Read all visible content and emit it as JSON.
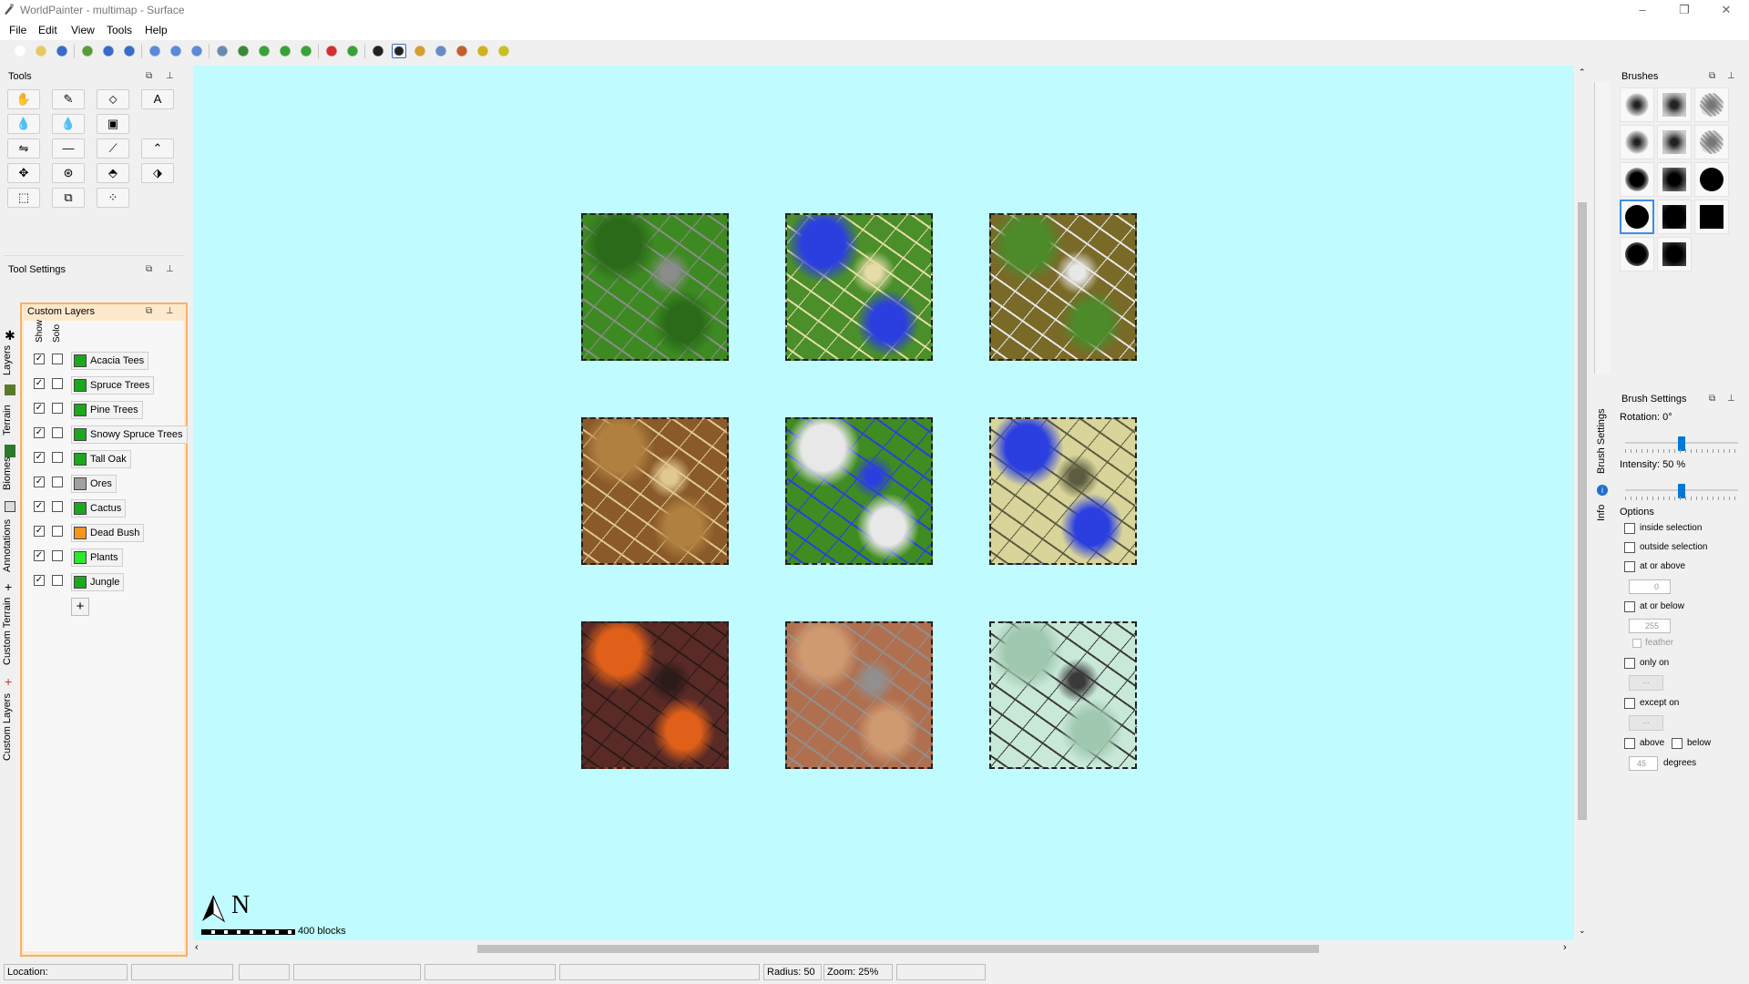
{
  "window": {
    "title": "WorldPainter - multimap - Surface",
    "controls": [
      "–",
      "❐",
      "✕"
    ]
  },
  "menu": [
    "File",
    "Edit",
    "View",
    "Tools",
    "Help"
  ],
  "toolbar_icons": [
    "new-icon",
    "open-icon",
    "save-icon",
    "export-icon",
    "undo-icon",
    "redo-icon",
    "zoom-in-icon",
    "zoom-reset-icon",
    "zoom-out-icon",
    "dimension-properties-icon",
    "raise-icon",
    "rotate-icon",
    "shift-icon",
    "add-tile-icon",
    "view-3d-icon",
    "fit-icon",
    "crosshair-icon",
    "target-icon",
    "image-icon",
    "eye-icon",
    "person-icon",
    "globe-icon",
    "ball-icon"
  ],
  "tools_panel": {
    "title": "Tools",
    "buttons": [
      [
        "✋",
        "✎",
        "⬦",
        "A"
      ],
      [
        "💧",
        "💧",
        "▣"
      ],
      [
        "⇋",
        "—",
        "⟋",
        "⌃"
      ],
      [
        "✥",
        "⊛",
        "⬘",
        "⬗"
      ],
      [
        "⬚",
        "⧉",
        "⁘"
      ]
    ]
  },
  "tool_settings": {
    "title": "Tool Settings"
  },
  "custom_layers": {
    "title": "Custom Layers",
    "col_show": "Show",
    "col_solo": "Solo",
    "add_label": "+",
    "items": [
      {
        "name": "Acacia Tees",
        "show": "☑",
        "color": "#1ca81c"
      },
      {
        "name": "Spruce Trees",
        "show": "☑",
        "color": "#1ca81c"
      },
      {
        "name": "Pine Trees",
        "show": "☑",
        "color": "#1ca81c"
      },
      {
        "name": "Snowy Spruce Trees",
        "show": "☑",
        "color": "#1ca81c"
      },
      {
        "name": "Tall Oak",
        "show": "☑",
        "color": "#1ca81c"
      },
      {
        "name": "Ores",
        "show": "☑",
        "color": "#a0a0a0"
      },
      {
        "name": "Cactus",
        "show": "☑",
        "color": "#1ca81c"
      },
      {
        "name": "Dead Bush",
        "show": "☑",
        "color": "#f7941d"
      },
      {
        "name": "Plants",
        "show": "☑",
        "color": "#2ee82e"
      },
      {
        "name": "Jungle",
        "show": "☑",
        "color": "#1ca81c"
      }
    ]
  },
  "left_tabs": [
    "Layers",
    "Terrain",
    "Biomes",
    "Annotations",
    "Custom Terrain",
    "Custom Layers"
  ],
  "map": {
    "background": "#c0fcff",
    "tiles": [
      {
        "base": "#3d8a22",
        "accent": "#8c8c8c",
        "accent2": "#2a6a18"
      },
      {
        "base": "#4a8f2a",
        "accent": "#e6dca8",
        "accent2": "#2b3fe0"
      },
      {
        "base": "#7a6a28",
        "accent": "#e8e8e8",
        "accent2": "#4c8a2a"
      },
      {
        "base": "#8a5a2a",
        "accent": "#e0c890",
        "accent2": "#b08040"
      },
      {
        "base": "#3f8c22",
        "accent": "#2b3fe0",
        "accent2": "#e8e8e8"
      },
      {
        "base": "#d8d49a",
        "accent": "#5c5c40",
        "accent2": "#2b3fe0"
      },
      {
        "base": "#5a2a26",
        "accent": "#2a1a18",
        "accent2": "#e0601a"
      },
      {
        "base": "#b07050",
        "accent": "#909090",
        "accent2": "#d09a70"
      },
      {
        "base": "#c8e8d8",
        "accent": "#3a3a3a",
        "accent2": "#a0c8b0"
      }
    ],
    "compass": "N",
    "scale_label": "400 blocks"
  },
  "brushes_panel": {
    "title": "Brushes"
  },
  "brush_settings": {
    "title": "Brush Settings",
    "rotation": "Rotation: 0°",
    "rotation_value": 0.5,
    "intensity": "Intensity: 50 %",
    "intensity_value": 0.5,
    "options_title": "Options",
    "inside_selection": "inside selection",
    "outside_selection": "outside selection",
    "at_or_above": "at or above",
    "at_or_above_value": "0",
    "at_or_below": "at or below",
    "at_or_below_value": "255",
    "feather": "feather",
    "only_on": "only on",
    "except_on": "except on",
    "ellipsis": "...",
    "above": "above",
    "below": "below",
    "degrees_value": "45",
    "degrees": "degrees"
  },
  "right_tabs": [
    "Brush Settings",
    "Info"
  ],
  "status": {
    "location": "Location:",
    "radius": "Radius: 50",
    "zoom": "Zoom: 25%"
  }
}
